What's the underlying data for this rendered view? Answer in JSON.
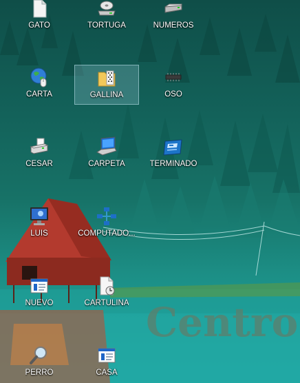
{
  "desktop": {
    "background_text": "Centro",
    "icons": [
      {
        "label": "GATO",
        "icon": "document-icon"
      },
      {
        "label": "TORTUGA",
        "icon": "disc-drive-icon"
      },
      {
        "label": "NUMEROS",
        "icon": "hard-drive-icon"
      },
      {
        "label": "CARTA",
        "icon": "globe-mouse-icon"
      },
      {
        "label": "GALLINA",
        "icon": "zip-folder-icon"
      },
      {
        "label": "OSO",
        "icon": "memory-chip-icon"
      },
      {
        "label": "CESAR",
        "icon": "printer-icon"
      },
      {
        "label": "CARPETA",
        "icon": "laptop-icon"
      },
      {
        "label": "TERMINADO",
        "icon": "control-panel-icon"
      },
      {
        "label": "LUIS",
        "icon": "monitor-icon"
      },
      {
        "label": "COMPUTADO...",
        "icon": "network-icon"
      },
      {
        "label": "NUEVO",
        "icon": "window-doc-icon"
      },
      {
        "label": "CARTULINA",
        "icon": "scheduled-doc-icon"
      },
      {
        "label": "PERRO",
        "icon": "magnifier-icon"
      },
      {
        "label": "CASA",
        "icon": "window-doc-icon"
      }
    ],
    "selected_icon": "GALLINA"
  }
}
